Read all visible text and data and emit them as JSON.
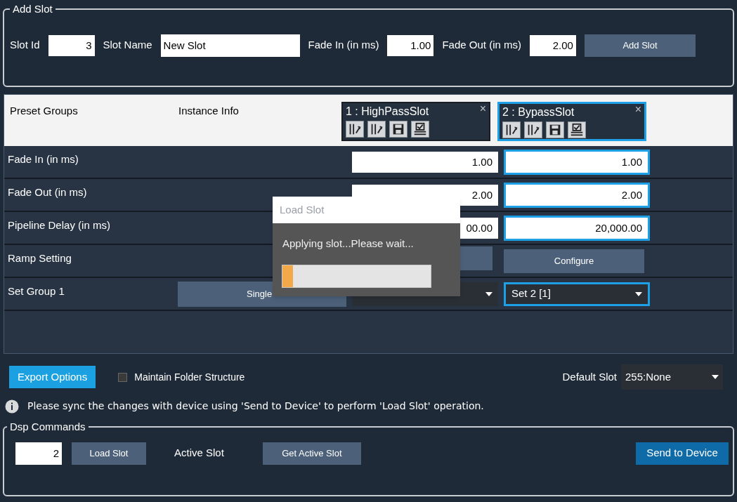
{
  "add_slot": {
    "title": "Add Slot",
    "slot_id_label": "Slot Id",
    "slot_id": "3",
    "slot_name_label": "Slot Name",
    "slot_name": "New Slot",
    "fade_in_label": "Fade In (in ms)",
    "fade_in": "1.00",
    "fade_out_label": "Fade Out (in ms)",
    "fade_out": "2.00",
    "button": "Add Slot"
  },
  "table": {
    "columns": [
      "Preset Groups",
      "Instance Info"
    ],
    "slots": [
      {
        "title": "1 : HighPassSlot",
        "close": "×",
        "selected": false
      },
      {
        "title": "2 : BypassSlot",
        "close": "×",
        "selected": true
      }
    ],
    "rows": [
      {
        "label": "Fade In (in ms)",
        "kind": "input",
        "cells": [
          {
            "value": "1.00"
          },
          {
            "value": "1.00"
          }
        ]
      },
      {
        "label": "Fade Out (in ms)",
        "kind": "input",
        "cells": [
          {
            "value": "2.00"
          },
          {
            "value": "2.00"
          }
        ]
      },
      {
        "label": "Pipeline Delay (in ms)",
        "kind": "input",
        "cells": [
          {
            "value": "00.00"
          },
          {
            "value": "20,000.00"
          }
        ]
      },
      {
        "label": "Ramp Setting",
        "kind": "button",
        "cells": [
          {},
          {
            "value": "Configure"
          }
        ]
      },
      {
        "label": "Set Group 1",
        "kind": "dropdown",
        "instance_button": "Single",
        "cells": [
          {},
          {
            "value": "Set 2 [1]"
          }
        ]
      }
    ]
  },
  "dialog": {
    "title": "Load Slot",
    "message": "Applying slot...Please wait...",
    "level": 0.07
  },
  "export_button": "Export Options",
  "maintain_folder": {
    "label": "Maintain Folder Structure",
    "checked": false
  },
  "default_slot": {
    "label": "Default Slot",
    "value": "255:None"
  },
  "info": "Please sync the changes with device using 'Send to Device' to perform 'Load Slot' operation.",
  "dsp": {
    "title": "Dsp Commands",
    "slot": "2",
    "load_button": "Load Slot",
    "active_label": "Active Slot",
    "get_button": "Get Active Slot",
    "send_button": "Send to Device"
  }
}
